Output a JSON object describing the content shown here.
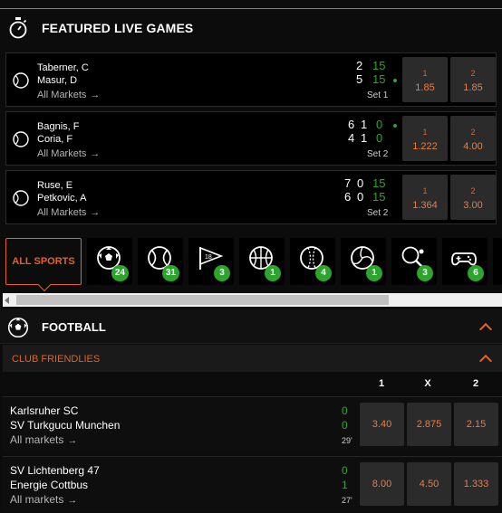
{
  "featured": {
    "title": "FEATURED LIVE GAMES",
    "games": [
      {
        "p1": "Taberner, C",
        "p2": "Masur, D",
        "all_markets": "All Markets",
        "s1": [
          "2"
        ],
        "s2": [
          "5"
        ],
        "pts1": "15",
        "pts2": "15",
        "set": "Set 1",
        "odds": [
          {
            "label": "1",
            "value": "1.85"
          },
          {
            "label": "2",
            "value": "1.85"
          }
        ]
      },
      {
        "p1": "Bagnis, F",
        "p2": "Coria, F",
        "all_markets": "All Markets",
        "s1": [
          "6",
          "1"
        ],
        "s2": [
          "4",
          "1"
        ],
        "pts1": "0",
        "pts2": "0",
        "set": "Set 2",
        "odds": [
          {
            "label": "1",
            "value": "1.222"
          },
          {
            "label": "2",
            "value": "4.00"
          }
        ]
      },
      {
        "p1": "Ruse, E",
        "p2": "Petkovic, A",
        "all_markets": "All Markets",
        "s1": [
          "7",
          "0"
        ],
        "s2": [
          "6",
          "0"
        ],
        "pts1": "15",
        "pts2": "15",
        "set": "Set 2",
        "odds": [
          {
            "label": "1",
            "value": "1.364"
          },
          {
            "label": "2",
            "value": "3.00"
          }
        ]
      }
    ]
  },
  "sports": {
    "all_label": "ALL SPORTS",
    "tiles": [
      {
        "icon": "football-icon",
        "count": "24"
      },
      {
        "icon": "tennis-icon",
        "count": "31"
      },
      {
        "icon": "golf-flag-icon",
        "count": "3"
      },
      {
        "icon": "basketball-icon",
        "count": "1"
      },
      {
        "icon": "cricket-icon",
        "count": "4"
      },
      {
        "icon": "volleyball-icon",
        "count": "1"
      },
      {
        "icon": "table-tennis-icon",
        "count": "3"
      },
      {
        "icon": "gamepad-icon",
        "count": "6"
      }
    ]
  },
  "football": {
    "title": "FOOTBALL",
    "league": "CLUB FRIENDLIES",
    "columns": [
      "1",
      "X",
      "2"
    ],
    "matches": [
      {
        "t1": "Karlsruher SC",
        "t2": "SV Turkgucu Munchen",
        "all_markets": "All markets",
        "g1": "0",
        "g2": "0",
        "minute": "29'",
        "odds": [
          "3.40",
          "2.875",
          "2.15"
        ]
      },
      {
        "t1": "SV Lichtenberg 47",
        "t2": "Energie Cottbus",
        "all_markets": "All markets",
        "g1": "0",
        "g2": "1",
        "minute": "27'",
        "odds": [
          "8.00",
          "4.50",
          "1.333"
        ]
      }
    ]
  },
  "colors": {
    "accent": "#e2622a",
    "live_green": "#2ca52c",
    "odds_bg": "#2b2b2b"
  }
}
